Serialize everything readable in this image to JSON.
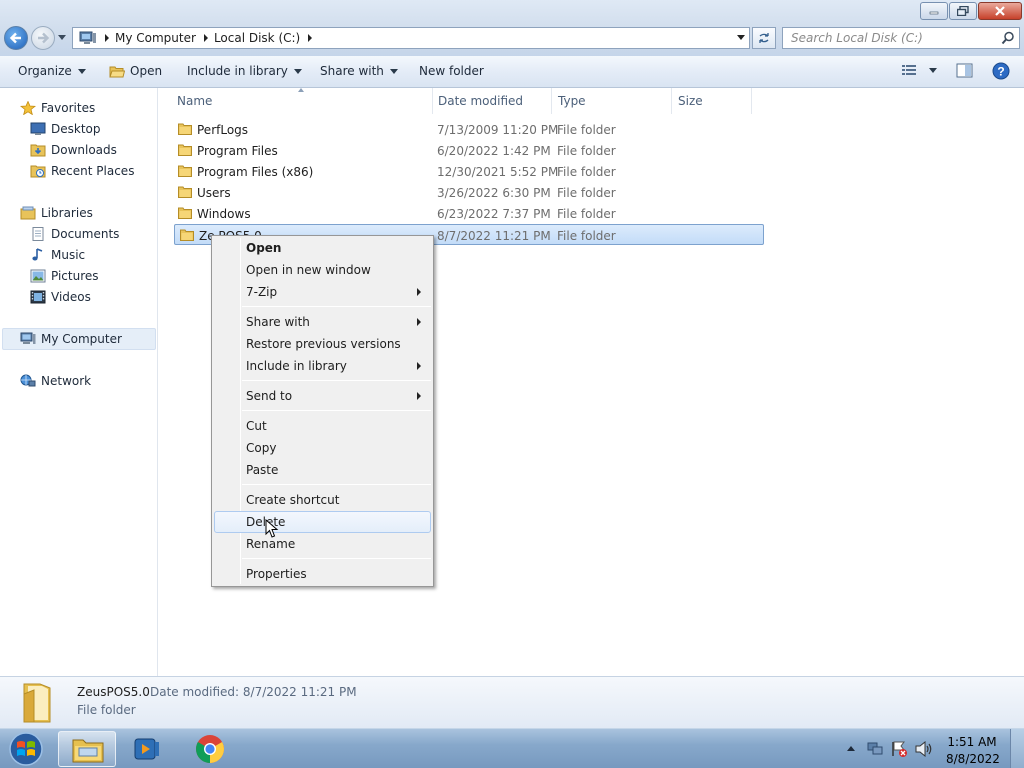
{
  "window": {
    "controls": {
      "minimize_icon": "minimize-icon",
      "maximize_icon": "restore-icon",
      "close_icon": "close-icon"
    }
  },
  "address": {
    "crumbs": [
      "My Computer",
      "Local Disk (C:)"
    ],
    "search_placeholder": "Search Local Disk (C:)"
  },
  "toolbar": {
    "organize": "Organize",
    "open": "Open",
    "include_in_library": "Include in library",
    "share_with": "Share with",
    "new_folder": "New folder"
  },
  "sidebar": {
    "favorites": "Favorites",
    "desktop": "Desktop",
    "downloads": "Downloads",
    "recent_places": "Recent Places",
    "libraries": "Libraries",
    "documents": "Documents",
    "music": "Music",
    "pictures": "Pictures",
    "videos": "Videos",
    "my_computer": "My Computer",
    "network": "Network"
  },
  "columns": {
    "name": "Name",
    "date_modified": "Date modified",
    "type": "Type",
    "size": "Size"
  },
  "files": [
    {
      "name": "PerfLogs",
      "date": "7/13/2009 11:20 PM",
      "type": "File folder"
    },
    {
      "name": "Program Files",
      "date": "6/20/2022 1:42 PM",
      "type": "File folder"
    },
    {
      "name": "Program Files (x86)",
      "date": "12/30/2021 5:52 PM",
      "type": "File folder"
    },
    {
      "name": "Users",
      "date": "3/26/2022 6:30 PM",
      "type": "File folder"
    },
    {
      "name": "Windows",
      "date": "6/23/2022 7:37 PM",
      "type": "File folder"
    },
    {
      "name": "Ze  POS5.0",
      "date": "8/7/2022 11:21 PM",
      "type": "File folder"
    }
  ],
  "context_menu": {
    "open": "Open",
    "open_new_window": "Open in new window",
    "seven_zip": "7-Zip",
    "share_with": "Share with",
    "restore_previous": "Restore previous versions",
    "include_in_library": "Include in library",
    "send_to": "Send to",
    "cut": "Cut",
    "copy": "Copy",
    "paste": "Paste",
    "create_shortcut": "Create shortcut",
    "delete": "Delete",
    "rename": "Rename",
    "properties": "Properties"
  },
  "details": {
    "name": "ZeusPOS5.0",
    "modified": "Date modified: 8/7/2022 11:21 PM",
    "type": "File folder"
  },
  "taskbar": {
    "time": "1:51 AM",
    "date": "8/8/2022"
  },
  "colors": {
    "selection": "#c3dcf8",
    "accent": "#1d5fb8",
    "taskbar": "#87a8cb"
  }
}
